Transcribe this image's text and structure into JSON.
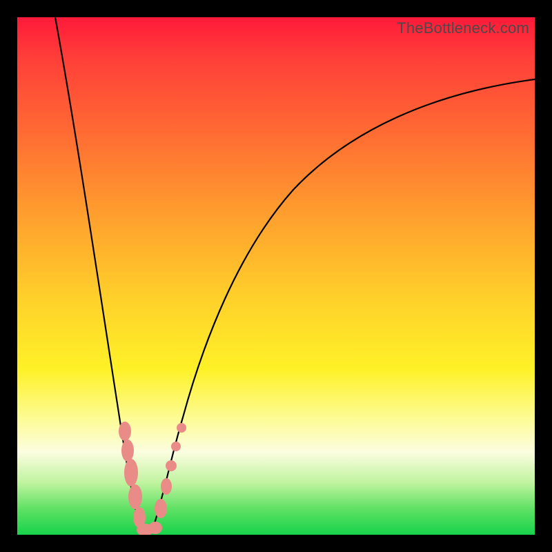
{
  "watermark": "TheBottleneck.com",
  "chart_data": {
    "type": "line",
    "title": "",
    "xlabel": "",
    "ylabel": "",
    "xlim": [
      0,
      100
    ],
    "ylim": [
      0,
      100
    ],
    "background_gradient_stops": [
      {
        "pos": 0,
        "color": "#ff1a3a"
      },
      {
        "pos": 22,
        "color": "#ff6a33"
      },
      {
        "pos": 55,
        "color": "#ffd22a"
      },
      {
        "pos": 78,
        "color": "#fdfc9a"
      },
      {
        "pos": 100,
        "color": "#17d24b"
      }
    ],
    "series": [
      {
        "name": "bottleneck-curve",
        "x": [
          7,
          12,
          16,
          19,
          22,
          24,
          25,
          27,
          30,
          34,
          40,
          50,
          65,
          80,
          100
        ],
        "y": [
          100,
          77,
          55,
          37,
          18,
          6,
          0,
          6,
          22,
          40,
          58,
          73,
          83,
          87,
          88
        ]
      }
    ],
    "markers": {
      "name": "highlighted-points",
      "color": "#e98b87",
      "x": [
        20.8,
        21.3,
        22.0,
        22.8,
        23.6,
        24.7,
        26.7,
        27.7,
        28.8,
        29.7,
        30.7,
        31.7
      ],
      "y": [
        20.0,
        16.3,
        12.0,
        7.3,
        3.3,
        0.9,
        1.3,
        5.1,
        9.3,
        13.3,
        17.1,
        20.7
      ]
    }
  }
}
